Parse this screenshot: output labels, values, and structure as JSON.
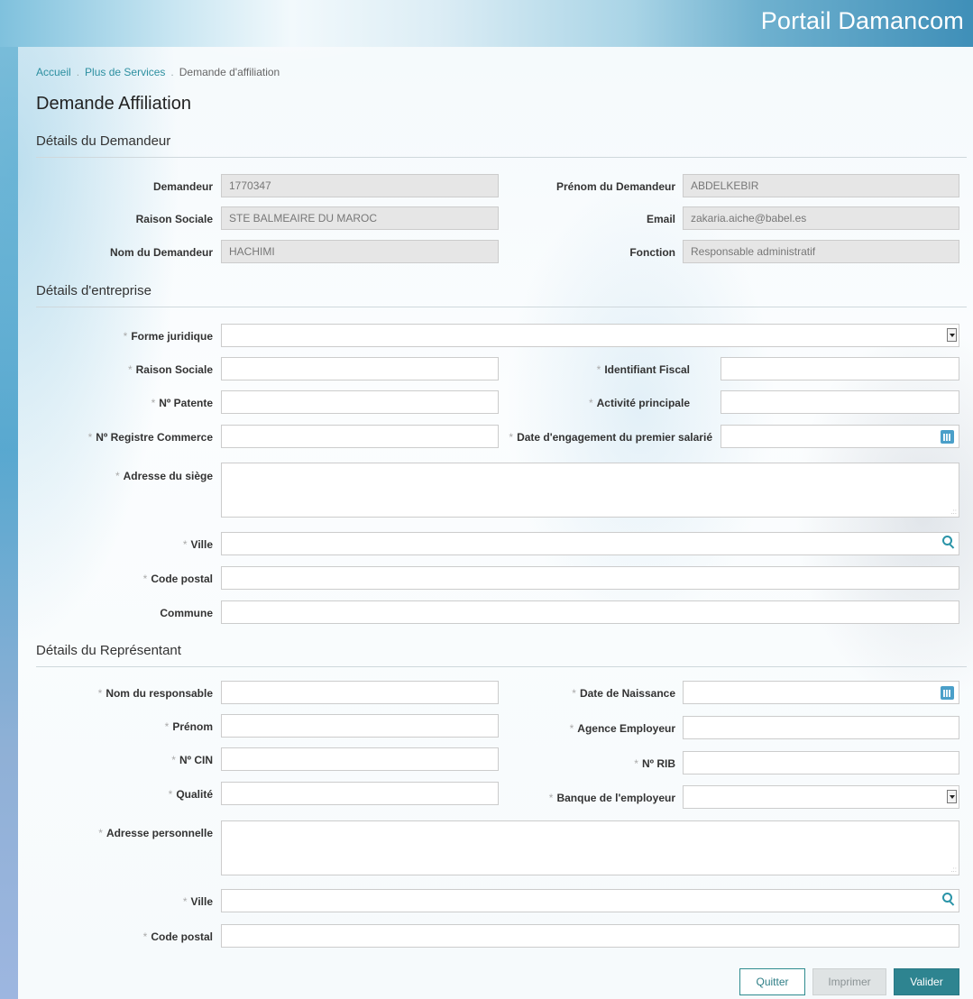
{
  "header": {
    "title": "Portail Damancom"
  },
  "breadcrumb": {
    "items": [
      "Accueil",
      "Plus de Services",
      "Demande d'affiliation"
    ]
  },
  "page_title": "Demande Affiliation",
  "sections": {
    "demandeur": "Détails du Demandeur",
    "entreprise": "Détails d'entreprise",
    "representant": "Détails du Représentant"
  },
  "demandeur": {
    "demandeur_label": "Demandeur",
    "demandeur_value": "1770347",
    "prenom_label": "Prénom du Demandeur",
    "prenom_value": "ABDELKEBIR",
    "raison_label": "Raison Sociale",
    "raison_value": "STE BALMEAIRE DU MAROC",
    "email_label": "Email",
    "email_value": "zakaria.aiche@babel.es",
    "nom_label": "Nom du Demandeur",
    "nom_value": "HACHIMI",
    "fonction_label": "Fonction",
    "fonction_value": "Responsable administratif"
  },
  "entreprise": {
    "forme_label": "Forme juridique",
    "forme_value": "",
    "raison_label": "Raison Sociale",
    "raison_value": "",
    "identifiant_label": "Identifiant Fiscal",
    "identifiant_value": "",
    "patente_label": "Nº Patente",
    "patente_value": "",
    "activite_label": "Activité principale",
    "activite_value": "",
    "registre_label": "Nº Registre Commerce",
    "registre_value": "",
    "date_label": "Date d'engagement du premier salarié",
    "date_value": "",
    "adresse_label": "Adresse du siège",
    "adresse_value": "",
    "ville_label": "Ville",
    "ville_value": "",
    "cp_label": "Code postal",
    "cp_value": "",
    "commune_label": "Commune",
    "commune_value": ""
  },
  "representant": {
    "nom_label": "Nom du responsable",
    "nom_value": "",
    "naissance_label": "Date de Naissance",
    "naissance_value": "",
    "prenom_label": "Prénom",
    "prenom_value": "",
    "agence_label": "Agence Employeur",
    "agence_value": "",
    "cin_label": "Nº CIN",
    "cin_value": "",
    "rib_label": "Nº RIB",
    "rib_value": "",
    "qualite_label": "Qualité",
    "qualite_value": "",
    "banque_label": "Banque de l'employeur",
    "banque_value": "",
    "adresse_label": "Adresse personnelle",
    "adresse_value": "",
    "ville_label": "Ville",
    "ville_value": "",
    "cp_label": "Code postal",
    "cp_value": ""
  },
  "required_marker": "*",
  "buttons": {
    "quit": "Quitter",
    "print": "Imprimer",
    "submit": "Valider"
  },
  "icons": {
    "dropdown": "chevron-down-icon",
    "calendar": "calendar-icon",
    "search": "search-icon"
  },
  "colors": {
    "accent": "#2e8490",
    "link": "#2c8fa0",
    "readonly_bg": "#e6e6e6"
  }
}
